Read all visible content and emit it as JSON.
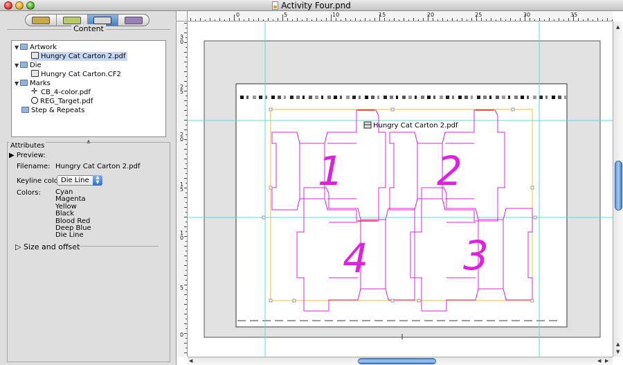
{
  "window": {
    "title": "Activity Four.pnd"
  },
  "tabs": [
    "artwork-tab",
    "die-tab",
    "step-tab",
    "marks-tab"
  ],
  "content": {
    "header": "Content",
    "tree": {
      "artwork_label": "Artwork",
      "artwork_file": "Hungry Cat Carton 2.pdf",
      "die_label": "Die",
      "die_file": "Hungry Cat Carton.CF2",
      "marks_label": "Marks",
      "marks_file1": "CB_4-color.pdf",
      "marks_file2": "REG_Target.pdf",
      "step_label": "Step & Repeats"
    }
  },
  "attributes": {
    "header": "Attributes",
    "preview_label": "Preview:",
    "filename_label": "Filename:",
    "filename_value": "Hungry Cat Carton 2.pdf",
    "keyline_label": "Keyline color:",
    "keyline_value": "Die Line",
    "colors_label": "Colors:",
    "colors": [
      "Cyan",
      "Magenta",
      "Yellow",
      "Black",
      "Blood Red",
      "Deep Blue",
      "Die Line"
    ],
    "size_offset_label": "Size and offset"
  },
  "ruler": {
    "top_labels": [
      "0",
      "5",
      "10",
      "15",
      "20",
      "25",
      "30",
      "35"
    ],
    "left_labels": [
      "3\n0",
      "2\n5",
      "2\n0",
      "1\n5",
      "1\n0",
      "5",
      "0"
    ]
  },
  "canvas": {
    "placed_label": "Hungry Cat Carton 2.pdf",
    "numbers": [
      "1",
      "2",
      "3",
      "4"
    ],
    "colors": {
      "die": "#e020e0",
      "bleed": "#f0c020",
      "guide": "#50e0e0",
      "cut": "#e02040"
    }
  }
}
